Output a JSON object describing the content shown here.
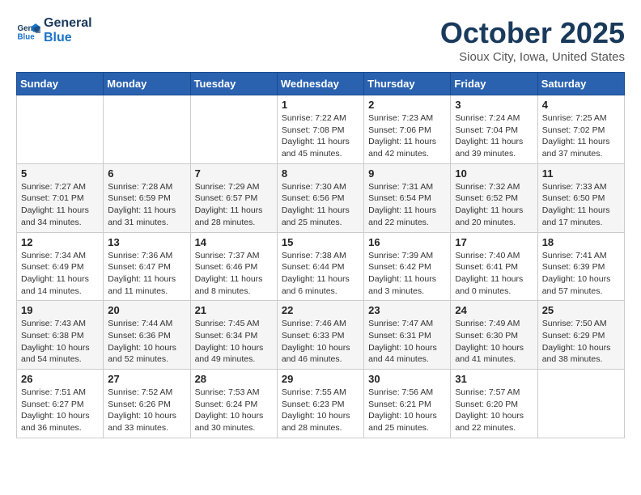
{
  "logo": {
    "line1": "General",
    "line2": "Blue"
  },
  "title": "October 2025",
  "subtitle": "Sioux City, Iowa, United States",
  "weekdays": [
    "Sunday",
    "Monday",
    "Tuesday",
    "Wednesday",
    "Thursday",
    "Friday",
    "Saturday"
  ],
  "weeks": [
    [
      {
        "day": "",
        "info": ""
      },
      {
        "day": "",
        "info": ""
      },
      {
        "day": "",
        "info": ""
      },
      {
        "day": "1",
        "info": "Sunrise: 7:22 AM\nSunset: 7:08 PM\nDaylight: 11 hours and 45 minutes."
      },
      {
        "day": "2",
        "info": "Sunrise: 7:23 AM\nSunset: 7:06 PM\nDaylight: 11 hours and 42 minutes."
      },
      {
        "day": "3",
        "info": "Sunrise: 7:24 AM\nSunset: 7:04 PM\nDaylight: 11 hours and 39 minutes."
      },
      {
        "day": "4",
        "info": "Sunrise: 7:25 AM\nSunset: 7:02 PM\nDaylight: 11 hours and 37 minutes."
      }
    ],
    [
      {
        "day": "5",
        "info": "Sunrise: 7:27 AM\nSunset: 7:01 PM\nDaylight: 11 hours and 34 minutes."
      },
      {
        "day": "6",
        "info": "Sunrise: 7:28 AM\nSunset: 6:59 PM\nDaylight: 11 hours and 31 minutes."
      },
      {
        "day": "7",
        "info": "Sunrise: 7:29 AM\nSunset: 6:57 PM\nDaylight: 11 hours and 28 minutes."
      },
      {
        "day": "8",
        "info": "Sunrise: 7:30 AM\nSunset: 6:56 PM\nDaylight: 11 hours and 25 minutes."
      },
      {
        "day": "9",
        "info": "Sunrise: 7:31 AM\nSunset: 6:54 PM\nDaylight: 11 hours and 22 minutes."
      },
      {
        "day": "10",
        "info": "Sunrise: 7:32 AM\nSunset: 6:52 PM\nDaylight: 11 hours and 20 minutes."
      },
      {
        "day": "11",
        "info": "Sunrise: 7:33 AM\nSunset: 6:50 PM\nDaylight: 11 hours and 17 minutes."
      }
    ],
    [
      {
        "day": "12",
        "info": "Sunrise: 7:34 AM\nSunset: 6:49 PM\nDaylight: 11 hours and 14 minutes."
      },
      {
        "day": "13",
        "info": "Sunrise: 7:36 AM\nSunset: 6:47 PM\nDaylight: 11 hours and 11 minutes."
      },
      {
        "day": "14",
        "info": "Sunrise: 7:37 AM\nSunset: 6:46 PM\nDaylight: 11 hours and 8 minutes."
      },
      {
        "day": "15",
        "info": "Sunrise: 7:38 AM\nSunset: 6:44 PM\nDaylight: 11 hours and 6 minutes."
      },
      {
        "day": "16",
        "info": "Sunrise: 7:39 AM\nSunset: 6:42 PM\nDaylight: 11 hours and 3 minutes."
      },
      {
        "day": "17",
        "info": "Sunrise: 7:40 AM\nSunset: 6:41 PM\nDaylight: 11 hours and 0 minutes."
      },
      {
        "day": "18",
        "info": "Sunrise: 7:41 AM\nSunset: 6:39 PM\nDaylight: 10 hours and 57 minutes."
      }
    ],
    [
      {
        "day": "19",
        "info": "Sunrise: 7:43 AM\nSunset: 6:38 PM\nDaylight: 10 hours and 54 minutes."
      },
      {
        "day": "20",
        "info": "Sunrise: 7:44 AM\nSunset: 6:36 PM\nDaylight: 10 hours and 52 minutes."
      },
      {
        "day": "21",
        "info": "Sunrise: 7:45 AM\nSunset: 6:34 PM\nDaylight: 10 hours and 49 minutes."
      },
      {
        "day": "22",
        "info": "Sunrise: 7:46 AM\nSunset: 6:33 PM\nDaylight: 10 hours and 46 minutes."
      },
      {
        "day": "23",
        "info": "Sunrise: 7:47 AM\nSunset: 6:31 PM\nDaylight: 10 hours and 44 minutes."
      },
      {
        "day": "24",
        "info": "Sunrise: 7:49 AM\nSunset: 6:30 PM\nDaylight: 10 hours and 41 minutes."
      },
      {
        "day": "25",
        "info": "Sunrise: 7:50 AM\nSunset: 6:29 PM\nDaylight: 10 hours and 38 minutes."
      }
    ],
    [
      {
        "day": "26",
        "info": "Sunrise: 7:51 AM\nSunset: 6:27 PM\nDaylight: 10 hours and 36 minutes."
      },
      {
        "day": "27",
        "info": "Sunrise: 7:52 AM\nSunset: 6:26 PM\nDaylight: 10 hours and 33 minutes."
      },
      {
        "day": "28",
        "info": "Sunrise: 7:53 AM\nSunset: 6:24 PM\nDaylight: 10 hours and 30 minutes."
      },
      {
        "day": "29",
        "info": "Sunrise: 7:55 AM\nSunset: 6:23 PM\nDaylight: 10 hours and 28 minutes."
      },
      {
        "day": "30",
        "info": "Sunrise: 7:56 AM\nSunset: 6:21 PM\nDaylight: 10 hours and 25 minutes."
      },
      {
        "day": "31",
        "info": "Sunrise: 7:57 AM\nSunset: 6:20 PM\nDaylight: 10 hours and 22 minutes."
      },
      {
        "day": "",
        "info": ""
      }
    ]
  ]
}
